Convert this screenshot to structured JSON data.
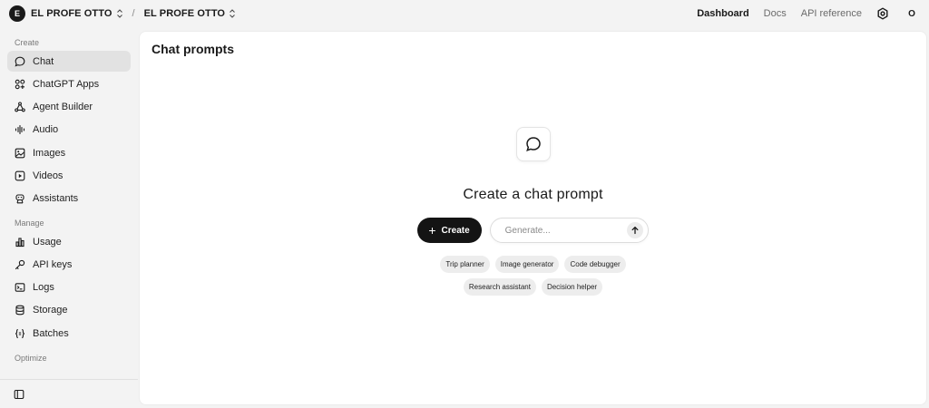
{
  "topbar": {
    "org_initial": "E",
    "org_name": "EL PROFE OTTO",
    "separator": "/",
    "project_name": "EL PROFE OTTO",
    "links": {
      "dashboard": "Dashboard",
      "docs": "Docs",
      "api_reference": "API reference"
    },
    "user_initial": "O"
  },
  "sidebar": {
    "sections": {
      "create": "Create",
      "manage": "Manage",
      "optimize": "Optimize"
    },
    "create_items": [
      {
        "label": "Chat",
        "icon": "chat-bubble-icon",
        "active": true
      },
      {
        "label": "ChatGPT Apps",
        "icon": "apps-grid-icon"
      },
      {
        "label": "Agent Builder",
        "icon": "agent-nodes-icon"
      },
      {
        "label": "Audio",
        "icon": "audio-wave-icon"
      },
      {
        "label": "Images",
        "icon": "image-icon"
      },
      {
        "label": "Videos",
        "icon": "video-play-icon"
      },
      {
        "label": "Assistants",
        "icon": "robot-icon"
      }
    ],
    "manage_items": [
      {
        "label": "Usage",
        "icon": "bar-chart-icon"
      },
      {
        "label": "API keys",
        "icon": "key-icon"
      },
      {
        "label": "Logs",
        "icon": "terminal-icon"
      },
      {
        "label": "Storage",
        "icon": "database-icon"
      },
      {
        "label": "Batches",
        "icon": "braces-icon"
      }
    ]
  },
  "main": {
    "title": "Chat prompts",
    "empty_title": "Create a chat prompt",
    "create_label": "Create",
    "generate_placeholder": "Generate...",
    "chips_row1": [
      "Trip planner",
      "Image generator",
      "Code debugger"
    ],
    "chips_row2": [
      "Research assistant",
      "Decision helper"
    ]
  },
  "colors": {
    "accent_dark": "#141414",
    "sidebar_active": "#e2e2e2",
    "page_bg": "#f3f3f3"
  }
}
